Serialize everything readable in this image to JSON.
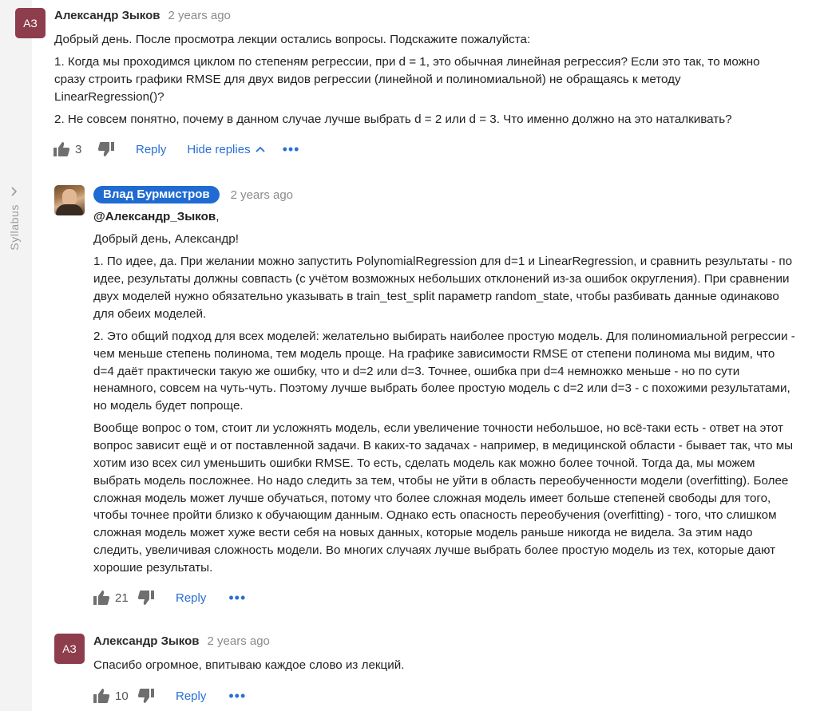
{
  "sidebar": {
    "label": "Syllabus"
  },
  "comments": {
    "c1": {
      "initials": "АЗ",
      "author": "Александр Зыков",
      "time": "2 years ago",
      "paragraphs": [
        "Добрый день. После просмотра лекции остались вопросы. Подскажите пожалуйста:",
        "1. Когда мы проходимся циклом по степеням регрессии, при d = 1, это обычная линейная регрессия? Если это так, то можно сразу строить графики RMSE для двух видов регрессии (линейной и полиномиальной) не обращаясь к методу LinearRegression()?",
        "2. Не совсем понятно, почему в данном случае лучше выбрать d = 2 или d = 3. Что именно должно на это наталкивать?"
      ],
      "likes": "3",
      "reply_label": "Reply",
      "hide_replies_label": "Hide replies",
      "more_label": "•••"
    },
    "c2": {
      "author": "Влад Бурмистров",
      "time": "2 years ago",
      "mention": "@Александр_Зыков",
      "mention_suffix": ",",
      "paragraphs": [
        "Добрый день, Александр!",
        "1. По идее, да. При желании можно запустить PolynomialRegression для d=1 и LinearRegression, и сравнить результаты - по идее, результаты должны совпасть (с учётом возможных небольших отклонений из-за ошибок округления). При сравнении двух моделей нужно обязательно указывать в train_test_split параметр random_state, чтобы разбивать данные одинаково для обеих моделей.",
        "2. Это общий подход для всех моделей: желательно выбирать наиболее простую модель. Для полиномиальной регрессии - чем меньше степень полинома, тем модель проще. На графике зависимости RMSE от степени полинома мы видим, что d=4 даёт практически такую же ошибку, что и d=2 или d=3. Точнее, ошибка при d=4 немножко меньше - но по сути ненамного, совсем на чуть-чуть. Поэтому лучше выбрать более простую модель с d=2 или d=3 - с похожими результатами, но модель будет попроще.",
        "Вообще вопрос о том, стоит ли усложнять модель, если увеличение точности небольшое, но всё-таки есть - ответ на этот вопрос зависит ещё и от поставленной задачи. В каких-то задачах - например, в медицинской области - бывает так, что мы хотим изо всех сил уменьшить ошибки RMSE. То есть, сделать модель как можно более точной. Тогда да, мы можем выбрать модель посложнее. Но надо следить за тем, чтобы не уйти в область переобученности модели (overfitting). Более сложная модель может лучше обучаться, потому что более сложная модель имеет больше степеней свободы для того, чтобы точнее пройти близко к обучающим данным. Однако есть опасность переобучения (overfitting) - того, что слишком сложная модель может хуже вести себя на новых данных, которые модель раньше никогда не видела. За этим надо следить, увеличивая сложность модели. Во многих случаях лучше выбрать более простую модель из тех, которые дают хорошие результаты."
      ],
      "likes": "21",
      "reply_label": "Reply",
      "more_label": "•••"
    },
    "c3": {
      "initials": "АЗ",
      "author": "Александр Зыков",
      "time": "2 years ago",
      "paragraphs": [
        "Спасибо огромное, впитываю каждое слово из лекций."
      ],
      "likes": "10",
      "reply_label": "Reply",
      "more_label": "•••"
    }
  },
  "icons": {
    "like": "thumbs-up-icon",
    "dislike": "thumbs-down-icon",
    "more": "more-dots-icon",
    "chevron": "chevron-icon"
  },
  "colors": {
    "avatar_bg": "#8e3d4d",
    "badge_bg": "#1f6bd1",
    "link": "#2a6fd6",
    "icon": "#6f6f6f"
  }
}
